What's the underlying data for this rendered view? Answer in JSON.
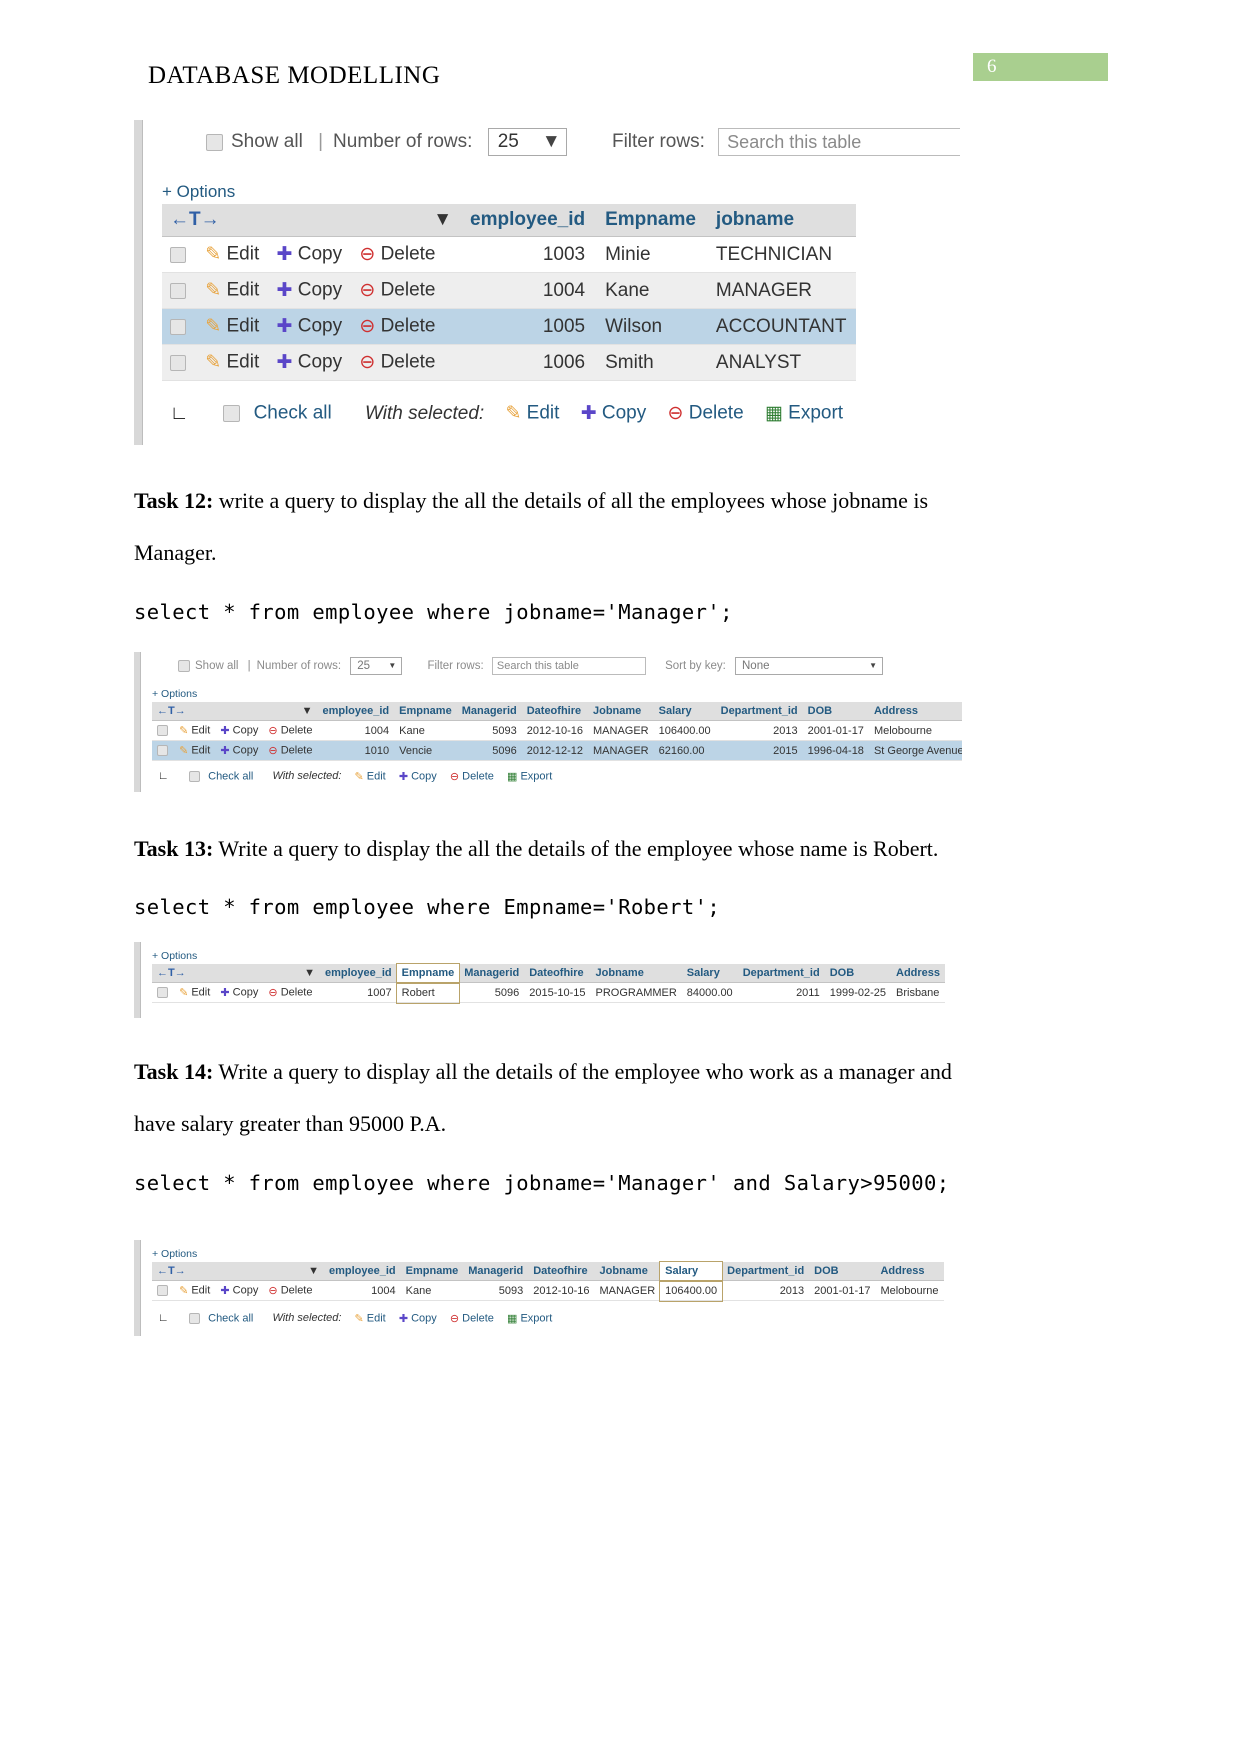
{
  "header": {
    "title": "DATABASE MODELLING",
    "page_number": "6",
    "badge_color": "#a9cf8f"
  },
  "shot1": {
    "toolbar": {
      "show_all_label": "Show all",
      "separator": "|",
      "rows_label": "Number of rows:",
      "rows_value": "25",
      "filter_label": "Filter rows:",
      "filter_placeholder": "Search this table"
    },
    "options_link": "+ Options",
    "sort_icon": "←T→",
    "dropdown_caret": "▼",
    "columns": [
      "employee_id",
      "Empname",
      "jobname"
    ],
    "row_actions": {
      "edit": "Edit",
      "copy": "Copy",
      "delete": "Delete"
    },
    "rows": [
      {
        "employee_id": "1003",
        "Empname": "Minie",
        "jobname": "TECHNICIAN",
        "state": "odd"
      },
      {
        "employee_id": "1004",
        "Empname": "Kane",
        "jobname": "MANAGER",
        "state": "even"
      },
      {
        "employee_id": "1005",
        "Empname": "Wilson",
        "jobname": "ACCOUNTANT",
        "state": "marked"
      },
      {
        "employee_id": "1006",
        "Empname": "Smith",
        "jobname": "ANALYST",
        "state": "even"
      }
    ],
    "footer": {
      "check_all": "Check all",
      "with_selected": "With selected:",
      "edit": "Edit",
      "copy": "Copy",
      "delete": "Delete",
      "export": "Export"
    }
  },
  "task12": {
    "label": "Task 12:",
    "text_line1": "write a query to display the all the details of all the employees whose jobname is",
    "text_line2": "Manager.",
    "sql": "select * from employee where jobname='Manager';"
  },
  "shot2": {
    "toolbar": {
      "show_all_label": "Show all",
      "separator": "|",
      "rows_label": "Number of rows:",
      "rows_value": "25",
      "filter_label": "Filter rows:",
      "filter_placeholder": "Search this table",
      "sort_label": "Sort by key:",
      "sort_value": "None"
    },
    "options_link": "+ Options",
    "sort_icon": "←T→",
    "dropdown_caret": "▼",
    "columns": [
      "employee_id",
      "Empname",
      "Managerid",
      "Dateofhire",
      "Jobname",
      "Salary",
      "Department_id",
      "DOB",
      "Address"
    ],
    "row_actions": {
      "edit": "Edit",
      "copy": "Copy",
      "delete": "Delete"
    },
    "rows": [
      {
        "employee_id": "1004",
        "Empname": "Kane",
        "Managerid": "5093",
        "Dateofhire": "2012-10-16",
        "Jobname": "MANAGER",
        "Salary": "106400.00",
        "Department_id": "2013",
        "DOB": "2001-01-17",
        "Address": "Melobourne",
        "state": "odd"
      },
      {
        "employee_id": "1010",
        "Empname": "Vencie",
        "Managerid": "5096",
        "Dateofhire": "2012-12-12",
        "Jobname": "MANAGER",
        "Salary": "62160.00",
        "Department_id": "2015",
        "DOB": "1996-04-18",
        "Address": "St George Avenue",
        "state": "marked"
      }
    ],
    "footer": {
      "check_all": "Check all",
      "with_selected": "With selected:",
      "edit": "Edit",
      "copy": "Copy",
      "delete": "Delete",
      "export": "Export"
    }
  },
  "task13": {
    "label": "Task 13:",
    "text_line1": "Write a query to display the all the details of the employee whose name is Robert.",
    "sql": "select * from employee where Empname='Robert';"
  },
  "shot3": {
    "options_link": "+ Options",
    "sort_icon": "←T→",
    "dropdown_caret": "▼",
    "columns": [
      "employee_id",
      "Empname",
      "Managerid",
      "Dateofhire",
      "Jobname",
      "Salary",
      "Department_id",
      "DOB",
      "Address"
    ],
    "highlight_column": "Empname",
    "row_actions": {
      "edit": "Edit",
      "copy": "Copy",
      "delete": "Delete"
    },
    "rows": [
      {
        "employee_id": "1007",
        "Empname": "Robert",
        "Managerid": "5096",
        "Dateofhire": "2015-10-15",
        "Jobname": "PROGRAMMER",
        "Salary": "84000.00",
        "Department_id": "2011",
        "DOB": "1999-02-25",
        "Address": "Brisbane",
        "state": "odd"
      }
    ]
  },
  "task14": {
    "label": "Task 14:",
    "text_line1": "Write a query to display all the details of the employee who work as a manager and",
    "text_line2": "have salary greater than 95000 P.A.",
    "sql": "select * from employee where jobname='Manager' and Salary>95000;"
  },
  "shot4": {
    "options_link": "+ Options",
    "sort_icon": "←T→",
    "dropdown_caret": "▼",
    "columns": [
      "employee_id",
      "Empname",
      "Managerid",
      "Dateofhire",
      "Jobname",
      "Salary",
      "Department_id",
      "DOB",
      "Address"
    ],
    "highlight_column": "Salary",
    "row_actions": {
      "edit": "Edit",
      "copy": "Copy",
      "delete": "Delete"
    },
    "rows": [
      {
        "employee_id": "1004",
        "Empname": "Kane",
        "Managerid": "5093",
        "Dateofhire": "2012-10-16",
        "Jobname": "MANAGER",
        "Salary": "106400.00",
        "Department_id": "2013",
        "DOB": "2001-01-17",
        "Address": "Melobourne",
        "state": "odd"
      }
    ],
    "footer": {
      "check_all": "Check all",
      "with_selected": "With selected:",
      "edit": "Edit",
      "copy": "Copy",
      "delete": "Delete",
      "export": "Export"
    }
  }
}
